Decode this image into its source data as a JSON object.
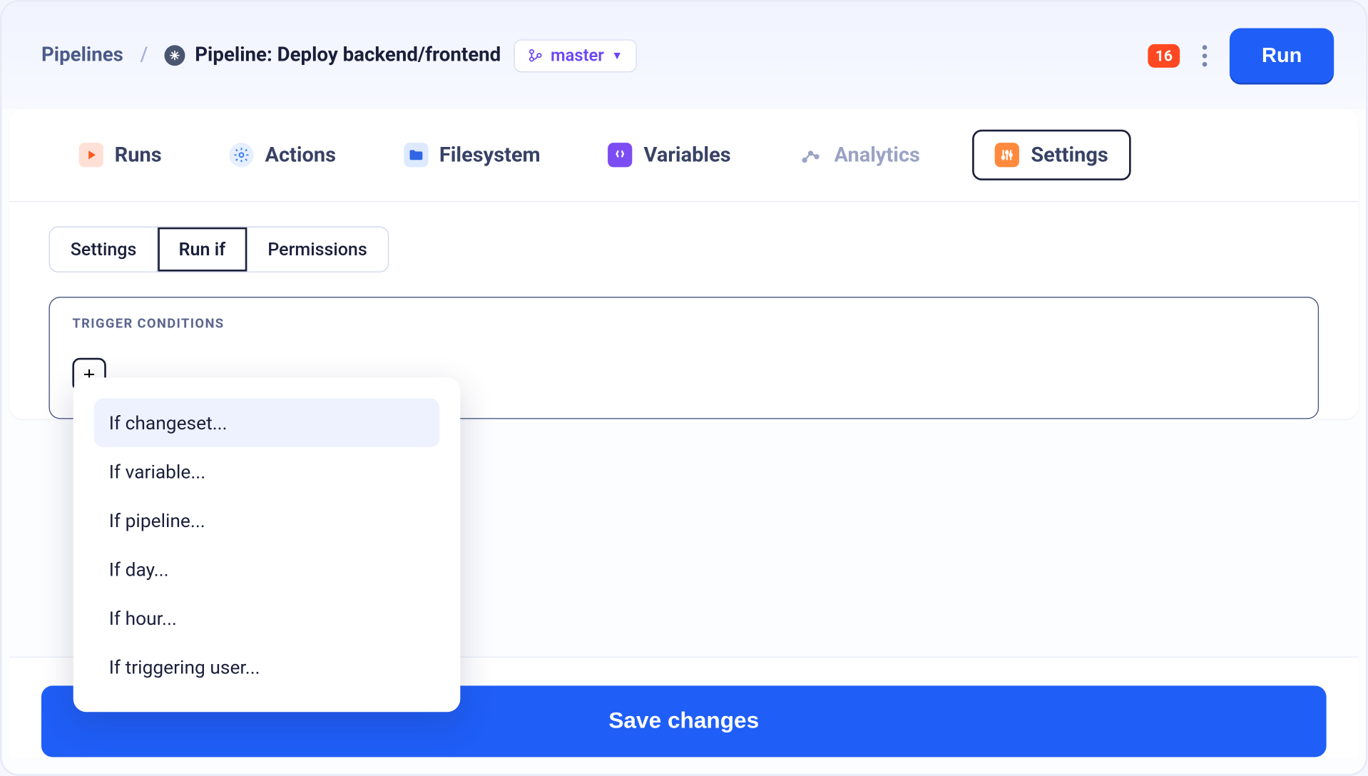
{
  "header": {
    "breadcrumb_root": "Pipelines",
    "page_title": "Pipeline: Deploy backend/frontend",
    "branch_label": "master",
    "notifications_count": "16",
    "run_button": "Run"
  },
  "main_tabs": {
    "runs": "Runs",
    "actions": "Actions",
    "filesystem": "Filesystem",
    "variables": "Variables",
    "analytics": "Analytics",
    "settings": "Settings"
  },
  "sub_tabs": {
    "settings": "Settings",
    "run_if": "Run if",
    "permissions": "Permissions"
  },
  "panel": {
    "title": "TRIGGER CONDITIONS",
    "add_label": "+"
  },
  "dropdown": {
    "items": [
      "If changeset...",
      "If variable...",
      "If pipeline...",
      "If day...",
      "If hour...",
      "If triggering user..."
    ]
  },
  "footer": {
    "save_button": "Save changes"
  }
}
